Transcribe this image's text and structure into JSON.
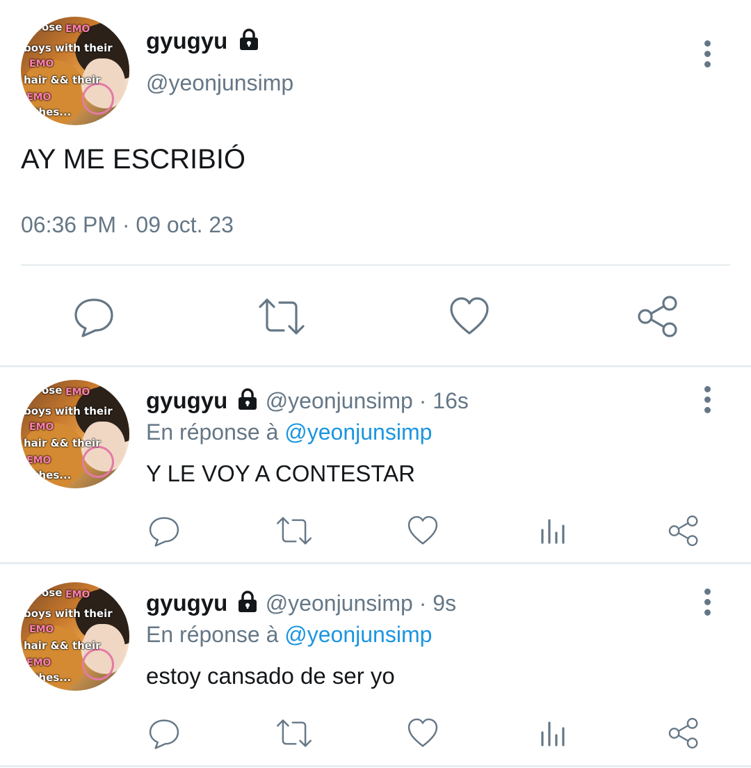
{
  "main_tweet": {
    "display_name": "gyugyu",
    "handle": "@yeonjunsimp",
    "text": "AY ME ESCRIBIÓ",
    "time": "06:36 PM",
    "dot": "·",
    "date": "09 oct. 23",
    "avatar_caption": [
      "ose",
      "EMO",
      "boys with their",
      "EMO",
      "hair && their",
      "EMO",
      "othes..."
    ],
    "actions": [
      "reply-icon",
      "retweet-icon",
      "like-icon",
      "share-icon"
    ]
  },
  "replies": [
    {
      "display_name": "gyugyu",
      "handle": "@yeonjunsimp",
      "dot": "·",
      "age": "16s",
      "reply_prefix": "En réponse à",
      "reply_handle": "@yeonjunsimp",
      "text": "Y LE VOY A CONTESTAR"
    },
    {
      "display_name": "gyugyu",
      "handle": "@yeonjunsimp",
      "dot": "·",
      "age": "9s",
      "reply_prefix": "En réponse à",
      "reply_handle": "@yeonjunsimp",
      "text": "estoy cansado de ser yo"
    }
  ],
  "colors": {
    "text": "#14171a",
    "secondary": "#657786",
    "link": "#1b95e0",
    "divider": "#e6ecf0"
  }
}
